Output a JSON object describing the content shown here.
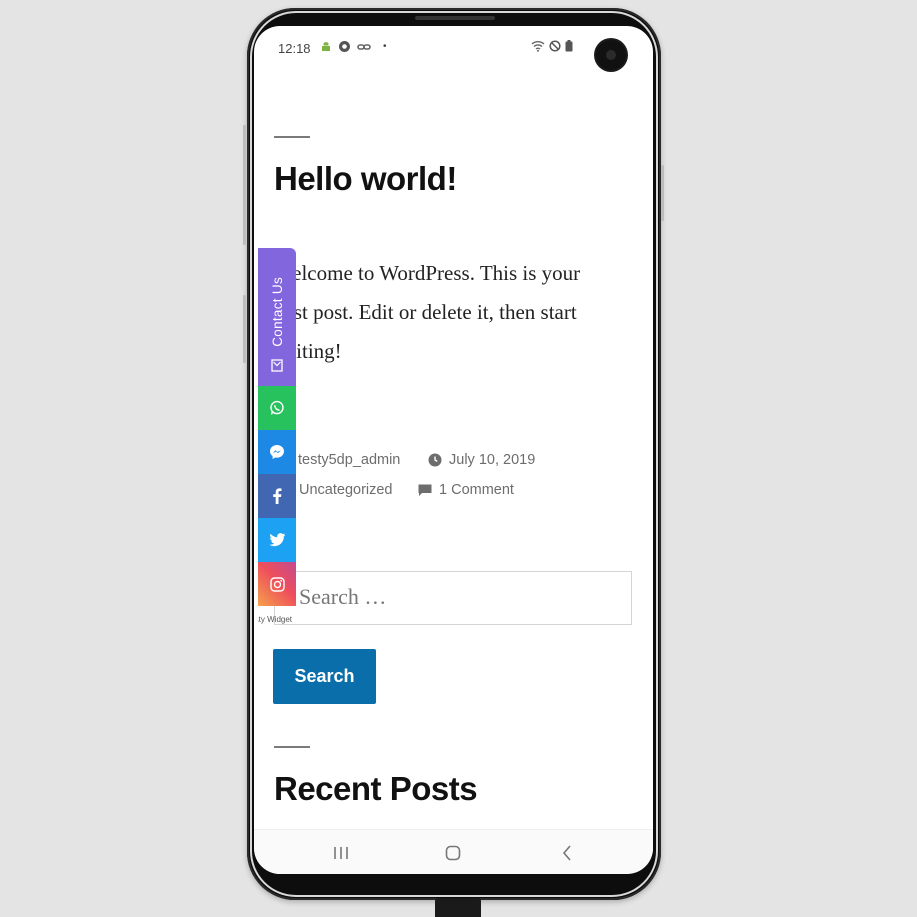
{
  "status_bar": {
    "time": "12:18"
  },
  "post": {
    "title": "Hello world!",
    "body": "Welcome to WordPress. This is your first post. Edit or delete it, then start writing!",
    "author": "testy5dp_admin",
    "date": "July 10, 2019",
    "category": "Uncategorized",
    "comments": "1 Comment"
  },
  "search": {
    "placeholder": "Search …",
    "button_label": "Search"
  },
  "widget_section": {
    "title": "Recent Posts"
  },
  "floating_widget": {
    "contact_label": "Contact Us",
    "channels": [
      "whatsapp-icon",
      "messenger-icon",
      "facebook-icon",
      "twitter-icon",
      "instagram-icon"
    ],
    "powered_by": "Chaty Widget"
  },
  "colors": {
    "button_blue": "#0a6eaa",
    "contact_purple": "#8266dd",
    "whatsapp_green": "#27c15d",
    "messenger_blue": "#1e88e5",
    "facebook_blue": "#4267b2",
    "twitter_blue": "#1da1f2"
  }
}
